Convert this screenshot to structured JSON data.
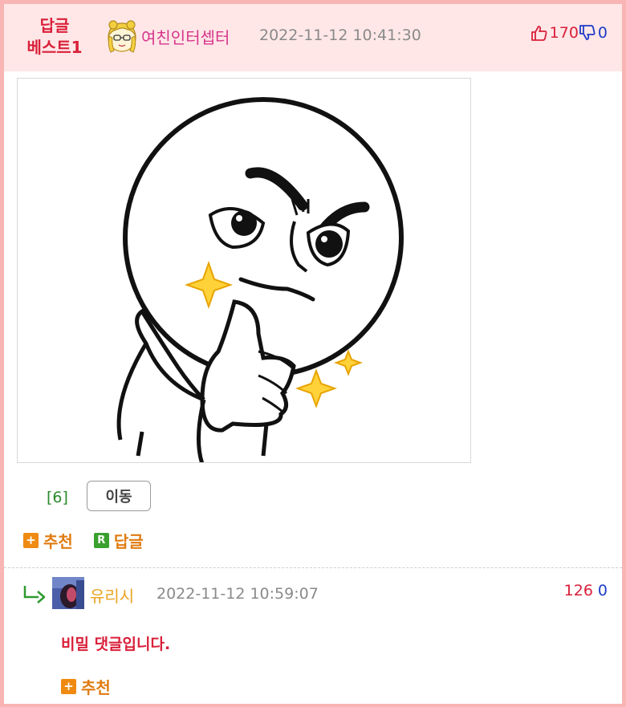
{
  "best_comment": {
    "badge": "답글 베스트1",
    "badge_line1": "답글",
    "badge_line2": "베스트1",
    "author": "여친인터셉터",
    "datetime": "2022-11-12 10:41:30",
    "upvotes": "170",
    "downvotes": "0",
    "image_alt_icon": "thumbs-up-sticker",
    "bracket_count": "[6]",
    "move_label": "이동",
    "recommend_label": "추천",
    "reply_label": "답글"
  },
  "reply_comment": {
    "author": "유리시",
    "datetime": "2022-11-12 10:59:07",
    "upvotes": "126",
    "downvotes": "0",
    "body": "비밀 댓글입니다.",
    "recommend_label": "추천"
  },
  "icons": {
    "plus_square": "+",
    "reply_square": "R"
  },
  "colors": {
    "frame_border": "#f9b4b4",
    "header_bg": "#ffe7e7",
    "accent_red": "#d9203a",
    "accent_orange": "#e07c12",
    "nick_pink": "#d6348b",
    "nick_yellow": "#e8a321"
  }
}
